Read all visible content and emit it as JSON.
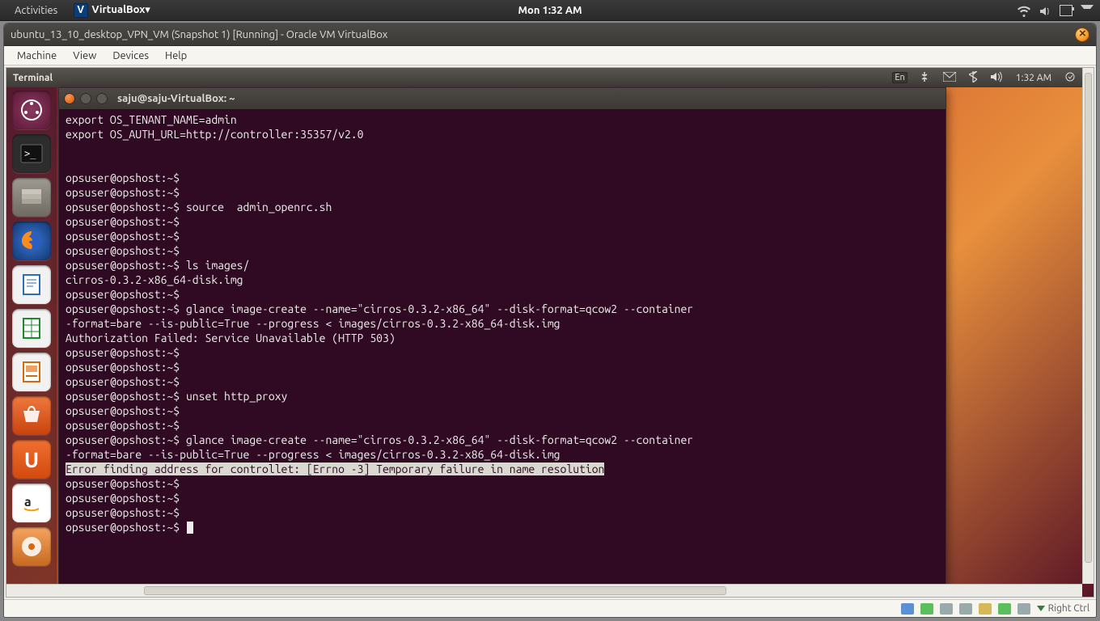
{
  "host": {
    "activities": "Activities",
    "vb_menu": "VirtualBox▾",
    "clock": "Mon  1:32 AM"
  },
  "vbwin": {
    "title": "ubuntu_13_10_desktop_VPN_VM (Snapshot 1) [Running] - Oracle VM VirtualBox",
    "menu": {
      "machine": "Machine",
      "view": "View",
      "devices": "Devices",
      "help": "Help"
    },
    "status_hint": "Right Ctrl"
  },
  "guest": {
    "app_title": "Terminal",
    "lang": "En",
    "clock": "1:32 AM",
    "term_title": "saju@saju-VirtualBox: ~"
  },
  "launcher": {
    "dash": "Dash",
    "terminal": "Terminal",
    "files": "Files",
    "firefox": "Firefox",
    "writer": "Writer",
    "calc": "Calc",
    "impress": "Impress",
    "software": "Software Center",
    "ubuntuone": "Ubuntu One",
    "amazon": "Amazon",
    "rhythmbox": "Rhythmbox"
  },
  "terminal_lines": [
    "export OS_TENANT_NAME=admin",
    "export OS_AUTH_URL=http://controller:35357/v2.0",
    "",
    "",
    "opsuser@opshost:~$",
    "opsuser@opshost:~$",
    "opsuser@opshost:~$ source  admin_openrc.sh",
    "opsuser@opshost:~$",
    "opsuser@opshost:~$",
    "opsuser@opshost:~$",
    "opsuser@opshost:~$ ls images/",
    "cirros-0.3.2-x86_64-disk.img",
    "opsuser@opshost:~$",
    "opsuser@opshost:~$ glance image-create --name=\"cirros-0.3.2-x86_64\" --disk-format=qcow2 --container",
    "-format=bare --is-public=True --progress < images/cirros-0.3.2-x86_64-disk.img",
    "Authorization Failed: Service Unavailable (HTTP 503)",
    "opsuser@opshost:~$",
    "opsuser@opshost:~$",
    "opsuser@opshost:~$",
    "opsuser@opshost:~$ unset http_proxy",
    "opsuser@opshost:~$",
    "opsuser@opshost:~$",
    "opsuser@opshost:~$ glance image-create --name=\"cirros-0.3.2-x86_64\" --disk-format=qcow2 --container",
    "-format=bare --is-public=True --progress < images/cirros-0.3.2-x86_64-disk.img"
  ],
  "terminal_selected": "Error finding address for controllet: [Errno -3] Temporary failure in name resolution",
  "terminal_tail": [
    "opsuser@opshost:~$",
    "opsuser@opshost:~$",
    "opsuser@opshost:~$",
    "opsuser@opshost:~$ "
  ]
}
